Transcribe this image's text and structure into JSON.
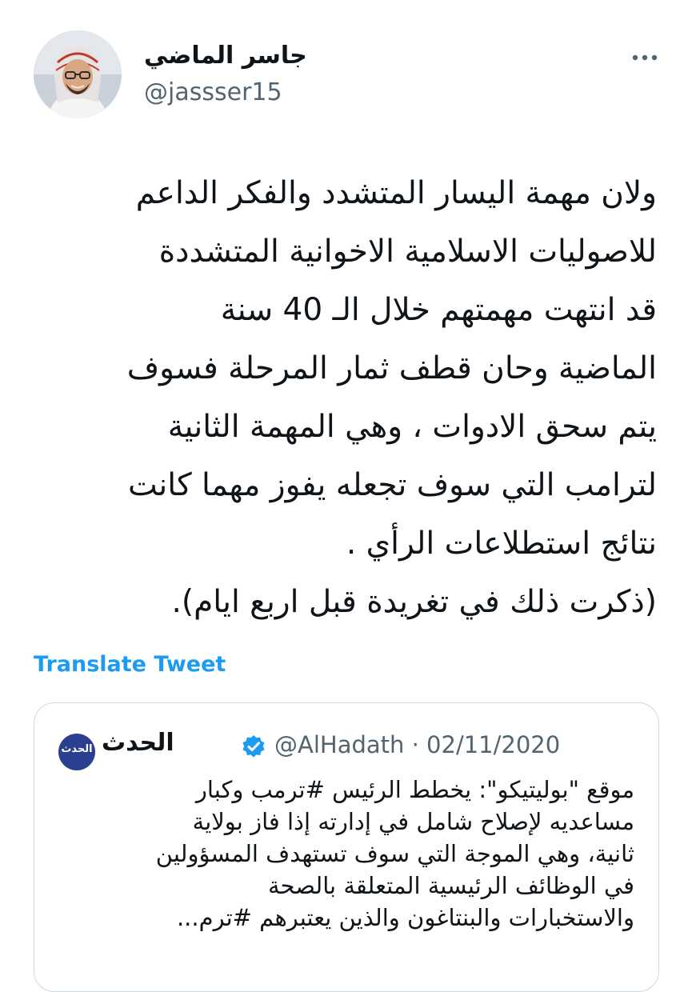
{
  "author": {
    "display_name": "جاسر الماضي",
    "handle": "@jassser15",
    "avatar_icon": "profile-photo"
  },
  "menu": {
    "more_icon": "more-horizontal-icon"
  },
  "tweet": {
    "lines": [
      "ولان مهمة اليسار المتشدد والفكر الداعم",
      "للاصوليات الاسلامية الاخوانية المتشددة",
      "قد انتهت مهمتهم خلال الـ 40 سنة",
      "الماضية وحان قطف ثمار المرحلة فسوف",
      "يتم سحق الادوات ، وهي المهمة الثانية",
      "لترامب التي سوف تجعله يفوز مهما كانت",
      "نتائج استطلاعات الرأي .",
      "(ذكرت ذلك في تغريدة قبل اربع ايام)."
    ],
    "translate_label": "Translate Tweet"
  },
  "quoted_tweet": {
    "avatar_text": "الحدث",
    "display_name": "الحدث",
    "verified_icon": "verified-badge-icon",
    "handle_date": "@AlHadath · 02/11/2020",
    "lines": [
      "موقع \"بوليتيكو\": يخطط الرئيس #ترمب وكبار",
      "مساعديه لإصلاح شامل في إدارته إذا فاز بولاية",
      "ثانية، وهي الموجة التي سوف تستهدف المسؤولين",
      "في الوظائف الرئيسية المتعلقة بالصحة",
      "والاستخبارات والبنتاغون والذين يعتبرهم #ترم..."
    ]
  },
  "colors": {
    "link": "#1d9bf0",
    "secondary_text": "#536471",
    "border": "#cfd9de",
    "verified": "#1d9bf0"
  }
}
